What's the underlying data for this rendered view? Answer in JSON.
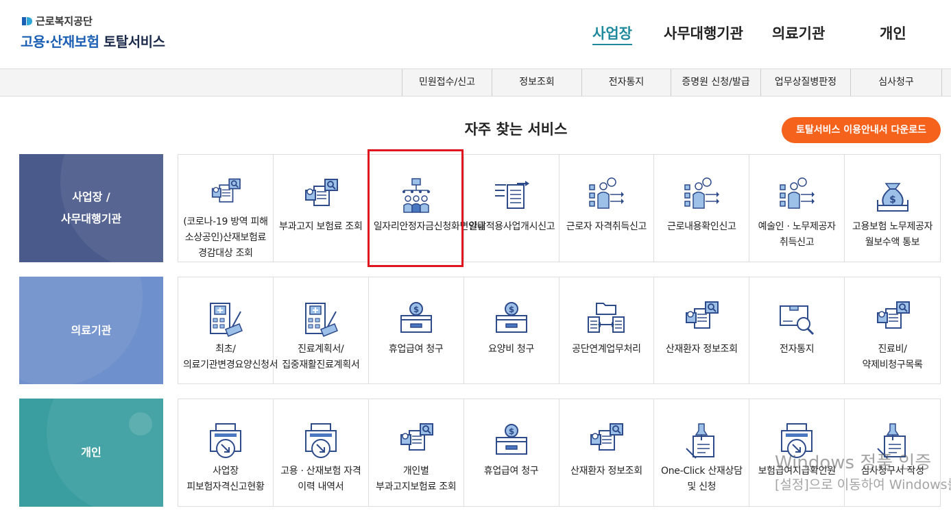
{
  "logo": {
    "org": "근로복지공단",
    "title_blue": "고용·산재보험",
    "title_dark": "토탈서비스"
  },
  "main_nav": [
    {
      "label": "사업장",
      "active": true
    },
    {
      "label": "사무대행기관",
      "active": false
    },
    {
      "label": "의료기관",
      "active": false
    },
    {
      "label": "개인",
      "active": false
    }
  ],
  "sub_nav": [
    "민원접수/신고",
    "정보조회",
    "전자통지",
    "증명원 신청/발급",
    "업무상질병판정",
    "심사청구"
  ],
  "section": {
    "title": "자주 찾는 서비스",
    "guide_button": "토탈서비스 이용안내서 다운로드"
  },
  "rows": [
    {
      "category": "사업장 /\n사무대행기관",
      "color": "#4a5a8a",
      "items": [
        {
          "label": "(코로나-19 방역 피해 소상공인)산재보험료 경감대상 조회",
          "icon": "search-document-icon"
        },
        {
          "label": "부과고지 보험료 조회",
          "icon": "search-document-icon"
        },
        {
          "label": "일자리안정자금신청화면안내",
          "icon": "org-chart-people-icon"
        },
        {
          "label": "일괄적용사업개시신고",
          "icon": "document-transfer-icon"
        },
        {
          "label": "근로자 자격취득신고",
          "icon": "worker-checklist-icon"
        },
        {
          "label": "근로내용확인신고",
          "icon": "worker-checklist-icon"
        },
        {
          "label": "예술인 · 노무제공자 취득신고",
          "icon": "worker-checklist-icon"
        },
        {
          "label": "고용보험 노무제공자 월보수액 통보",
          "icon": "money-bag-icon"
        }
      ]
    },
    {
      "category": "의료기관",
      "color": "#6e90cc",
      "items": [
        {
          "label": "최초/의료기관변경요양신청서",
          "icon": "hospital-form-icon"
        },
        {
          "label": "진료계획서/집중재활진료계획서",
          "icon": "hospital-form-icon"
        },
        {
          "label": "휴업급여 청구",
          "icon": "coin-box-icon"
        },
        {
          "label": "요양비 청구",
          "icon": "coin-box-icon"
        },
        {
          "label": "공단연계업무처리",
          "icon": "folder-exchange-icon"
        },
        {
          "label": "산재환자 정보조회",
          "icon": "search-document-icon"
        },
        {
          "label": "전자통지",
          "icon": "mail-search-icon"
        },
        {
          "label": "진료비/약제비청구목록",
          "icon": "search-document-icon"
        }
      ]
    },
    {
      "category": "개인",
      "color": "#3a9ea0",
      "items": [
        {
          "label": "사업장 피보험자격신고현황",
          "icon": "printer-download-icon"
        },
        {
          "label": "고용 · 산재보험 자격 이력 내역서",
          "icon": "printer-download-icon"
        },
        {
          "label": "개인별 부과고지보험료 조회",
          "icon": "search-document-icon"
        },
        {
          "label": "휴업급여 청구",
          "icon": "coin-box-icon"
        },
        {
          "label": "산재환자 정보조회",
          "icon": "search-document-icon"
        },
        {
          "label": "One-Click 산재상담 및 신청",
          "icon": "pin-document-icon"
        },
        {
          "label": "보험급여지급확인원",
          "icon": "printer-download-icon"
        },
        {
          "label": "심사청구서 작성",
          "icon": "pin-document-icon"
        }
      ]
    }
  ],
  "watermark": {
    "line1": "Windows 정품 인증",
    "line2": "[설정]으로 이동하여 Windows를 정품 인증합니다."
  }
}
